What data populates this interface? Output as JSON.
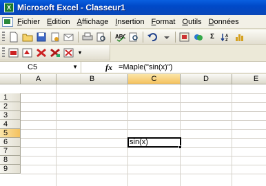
{
  "window": {
    "title": "Microsoft Excel - Classeur1",
    "app_icon_glyph": "X"
  },
  "menu": [
    "Fichier",
    "Edition",
    "Affichage",
    "Insertion",
    "Format",
    "Outils",
    "Données"
  ],
  "formula_bar": {
    "name_box": "C5",
    "fx_label": "fx",
    "formula": "=Maple(\"sin(x)\")"
  },
  "columns": [
    "A",
    "B",
    "C",
    "D",
    "E"
  ],
  "rows": [
    "1",
    "2",
    "3",
    "4",
    "5",
    "6",
    "7",
    "8",
    "9"
  ],
  "selected_column": "C",
  "selected_row": "5",
  "cells": {
    "C5": "sin(x)"
  },
  "toolbar_icons": {
    "standard": [
      "new-icon",
      "open-icon",
      "save-icon",
      "permission-icon",
      "email-icon",
      "print-icon",
      "print-preview-icon",
      "spelling-icon",
      "research-icon",
      "undo-icon",
      "redo-icon",
      "maple-icon",
      "hyperlink-icon",
      "autosum-icon",
      "sort-icon",
      "chart-icon"
    ],
    "maple": [
      "maple-a-icon",
      "maple-b-icon",
      "maple-c-icon",
      "maple-d-icon",
      "maple-e-icon"
    ]
  },
  "colors": {
    "title_bar": "#0a5fe0",
    "selection_header": "#f4c15e",
    "grid_line": "#d4d0c8"
  }
}
